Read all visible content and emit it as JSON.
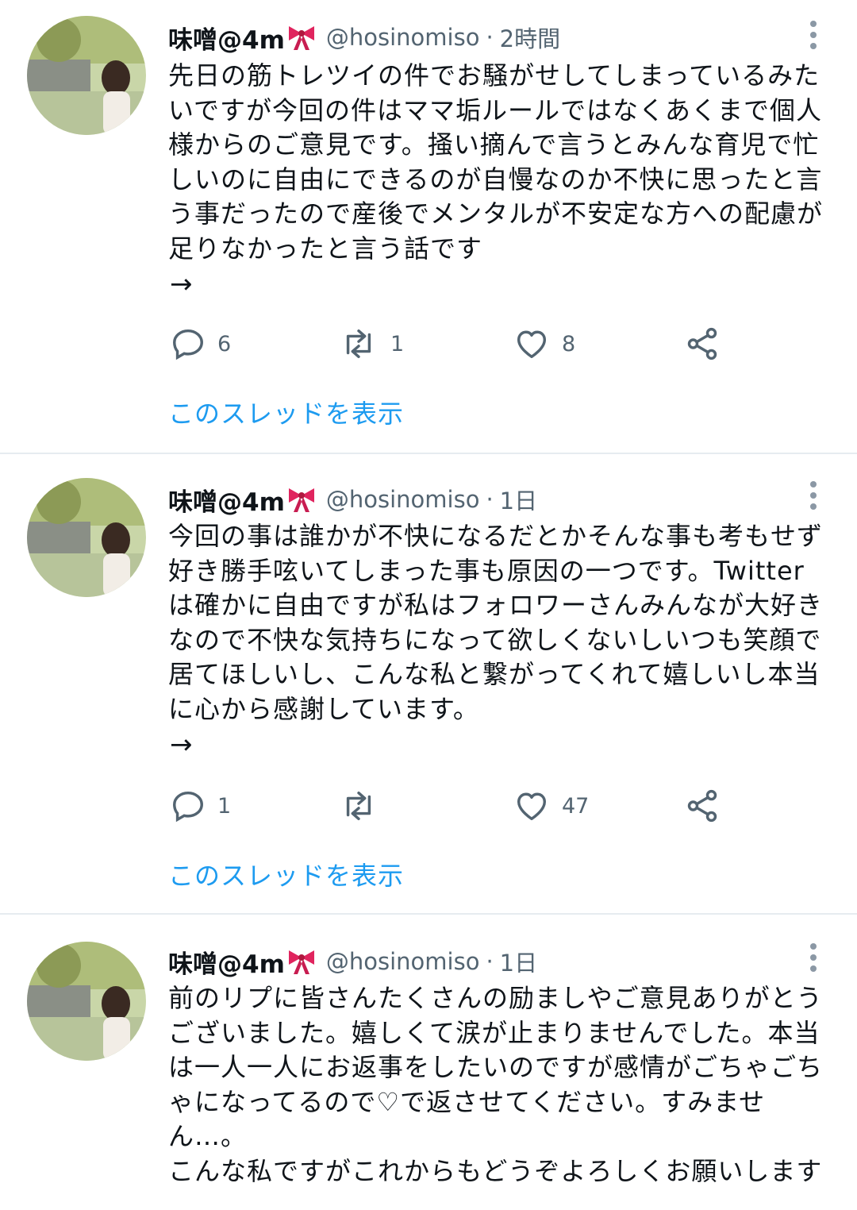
{
  "tweets": [
    {
      "author_name": "味噌@4m",
      "handle": "@hosinomiso",
      "separator": "·",
      "time": "2時間",
      "text": "先日の筋トレツイの件でお騒がせしてしまっているみたいですが今回の件はママ垢ルールではなくあくまで個人様からのご意見です。掻い摘んで言うとみんな育児で忙しいのに自由にできるのが自慢なのか不快に思ったと言う事だったので産後でメンタルが不安定な方への配慮が足りなかったと言う話です",
      "arrow": "→",
      "reply_count": "6",
      "retweet_count": "1",
      "like_count": "8",
      "show_thread": "このスレッドを表示"
    },
    {
      "author_name": "味噌@4m",
      "handle": "@hosinomiso",
      "separator": "·",
      "time": "1日",
      "text": "今回の事は誰かが不快になるだとかそんな事も考もせず好き勝手呟いてしまった事も原因の一つです。Twitterは確かに自由ですが私はフォロワーさんみんなが大好きなので不快な気持ちになって欲しくないしいつも笑顔で居てほしいし、こんな私と繋がってくれて嬉しいし本当に心から感謝しています。",
      "arrow": "→",
      "reply_count": "1",
      "retweet_count": "",
      "like_count": "47",
      "show_thread": "このスレッドを表示"
    },
    {
      "author_name": "味噌@4m",
      "handle": "@hosinomiso",
      "separator": "·",
      "time": "1日",
      "text": "前のリプに皆さんたくさんの励ましやご意見ありがとうございました。嬉しくて涙が止まりませんでした。本当は一人一人にお返事をしたいのですが感情がごちゃごちゃになってるので♡で返させてください。すみません…。\nこんな私ですがこれからもどうぞよろしくお願いします",
      "arrow": "",
      "reply_count": "",
      "retweet_count": "",
      "like_count": "",
      "show_thread": ""
    }
  ],
  "icons": {
    "bow": "ribbon-bow-icon",
    "more": "more-vertical-icon",
    "reply": "reply-icon",
    "retweet": "retweet-icon",
    "like": "heart-icon",
    "share": "share-icon"
  },
  "colors": {
    "link": "#1d9bf0",
    "secondary_text": "#536471",
    "bow": "#e0245e",
    "divider": "#e6ecf0"
  }
}
